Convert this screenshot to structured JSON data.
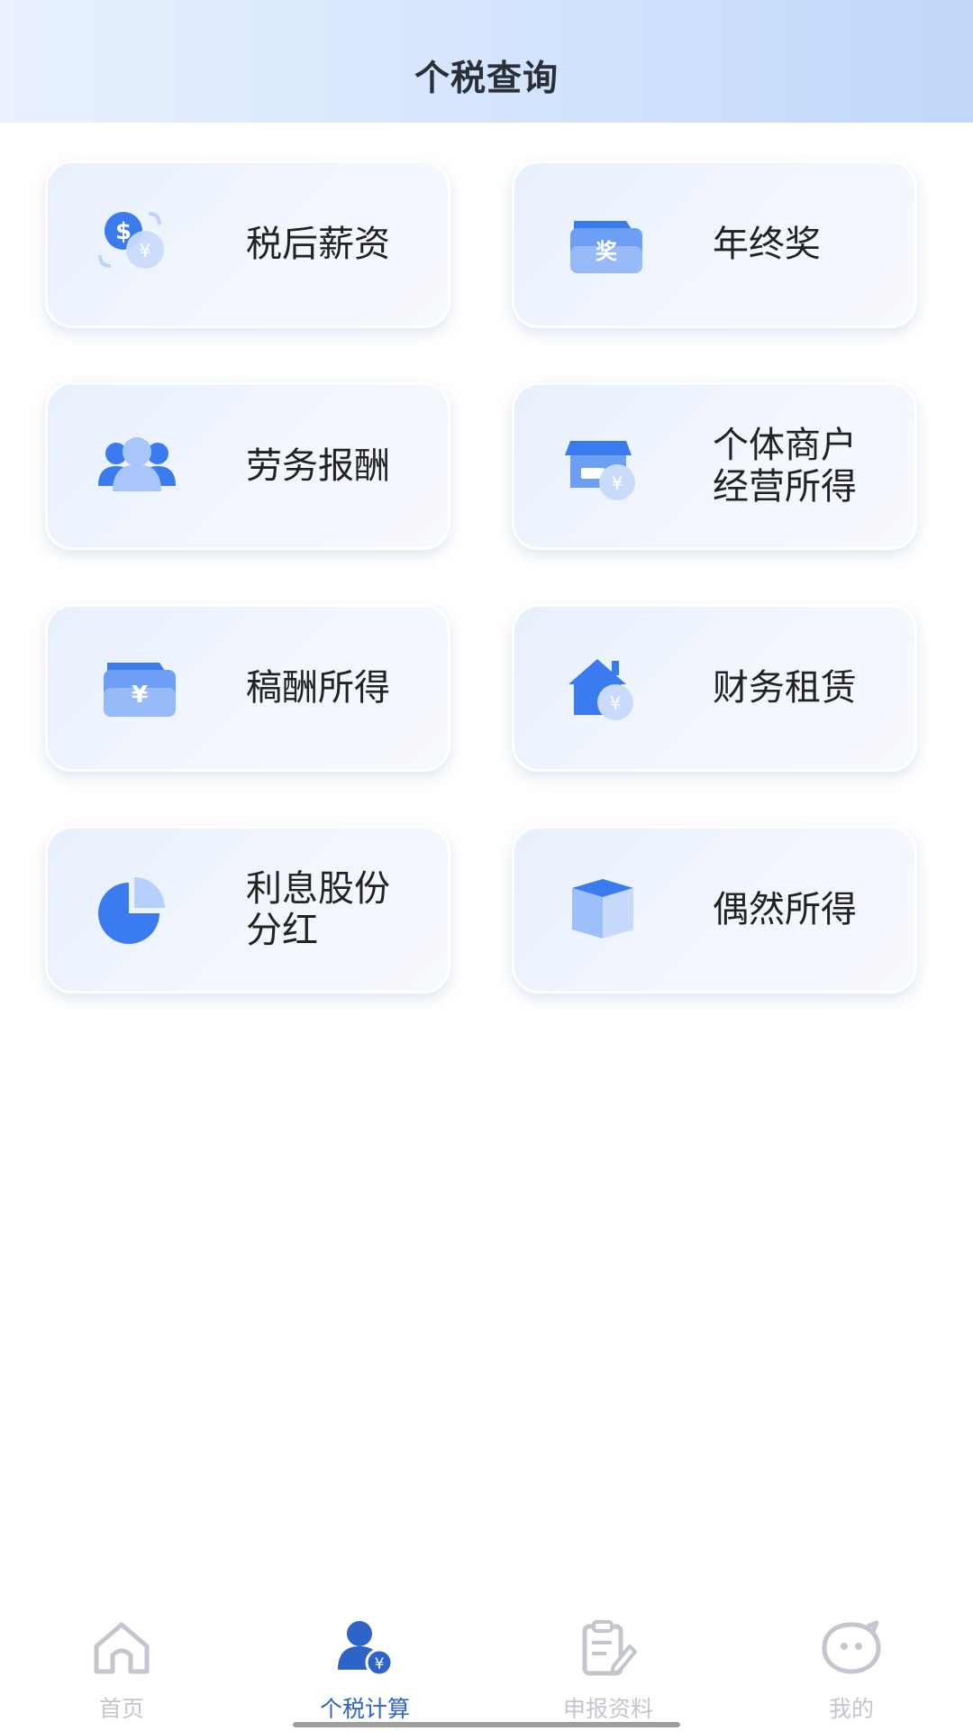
{
  "header": {
    "title": "个税查询"
  },
  "cards": [
    {
      "label": "税后薪资",
      "icon": "salary-exchange-icon"
    },
    {
      "label": "年终奖",
      "icon": "year-end-bonus-icon"
    },
    {
      "label": "劳务报酬",
      "icon": "people-icon"
    },
    {
      "label": "个体商户\n经营所得",
      "icon": "store-yuan-icon"
    },
    {
      "label": "稿酬所得",
      "icon": "wallet-yuan-icon"
    },
    {
      "label": "财务租赁",
      "icon": "house-yuan-icon"
    },
    {
      "label": "利息股份\n分红",
      "icon": "pie-chart-icon"
    },
    {
      "label": "偶然所得",
      "icon": "box-icon"
    }
  ],
  "tabbar": {
    "items": [
      {
        "label": "首页",
        "icon": "home-icon"
      },
      {
        "label": "个税计算",
        "icon": "user-yuan-icon"
      },
      {
        "label": "申报资料",
        "icon": "clipboard-edit-icon"
      },
      {
        "label": "我的",
        "icon": "chat-face-icon"
      }
    ],
    "active": "个税计算"
  },
  "colors": {
    "accent": "#2e63c8",
    "icon_blue": "#3b7bf0",
    "tab_inactive": "#c3c6cc",
    "card_bg": "#eef3fd"
  }
}
